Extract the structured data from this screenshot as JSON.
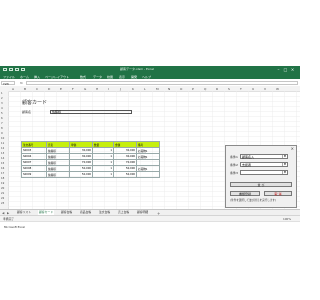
{
  "window": {
    "title": "顧客データ.xlsm - Excel"
  },
  "menu": {
    "items": [
      "ファイル",
      "ホーム",
      "挿入",
      "ページレイアウト",
      "数式",
      "データ",
      "校閲",
      "表示",
      "開発",
      "ヘルプ"
    ]
  },
  "formula_bar": {
    "name_box": "Y23",
    "fx": "fx",
    "value": ""
  },
  "columns": [
    "A",
    "B",
    "C",
    "D",
    "E",
    "F",
    "G",
    "H",
    "I",
    "J",
    "K",
    "L",
    "M",
    "N",
    "O",
    "P",
    "Q",
    "R",
    "S",
    "T",
    "U",
    "V",
    "W"
  ],
  "rows": [
    "1",
    "2",
    "3",
    "4",
    "5",
    "6",
    "7",
    "8",
    "9",
    "10",
    "11",
    "12",
    "13",
    "14",
    "15",
    "16",
    "17",
    "18",
    "19",
    "20",
    "21",
    "22",
    "23"
  ],
  "sheet": {
    "title": "顧客カード",
    "name_label": "顧客名",
    "name_value": "佐藤様"
  },
  "table": {
    "headers": [
      "注文番号",
      "氏名",
      "単価",
      "数量",
      "金額",
      "備考"
    ],
    "rows": [
      [
        "S0003",
        "佐藤様",
        "30,000",
        "1",
        "30,000",
        "お買物1"
      ],
      [
        "S0004",
        "佐藤様",
        "30,000",
        "1",
        "30,000",
        "お買物1"
      ],
      [
        "S0007",
        "佐藤様",
        "70,000",
        "1",
        "70,000",
        ""
      ],
      [
        "S0008",
        "佐藤様",
        "50,000",
        "1",
        "50,000",
        "お買物1"
      ],
      [
        "S0009",
        "佐藤様",
        "50,000",
        "1",
        "50,000",
        ""
      ]
    ]
  },
  "sort_panel": {
    "close": "×",
    "rows": [
      {
        "label": "条件1",
        "value": "顧客名入"
      },
      {
        "label": "条件2",
        "value": "支援者"
      },
      {
        "label": "条件3",
        "value": ""
      }
    ],
    "sort_button": "並 び",
    "reset_button": "書類登録",
    "cancel_button": "取 消",
    "note": "(条件を選択して並び替えを実行します)"
  },
  "sheet_tabs": [
    "顧客リスト",
    "顧客カード",
    "顧客台帳",
    "商品台帳",
    "注文台帳",
    "売上台帳",
    "顧客明細"
  ],
  "active_tab": 1,
  "status": {
    "left": "準備完了",
    "right": "100%"
  },
  "taskbar": {
    "text": "Microsoft Excel"
  }
}
